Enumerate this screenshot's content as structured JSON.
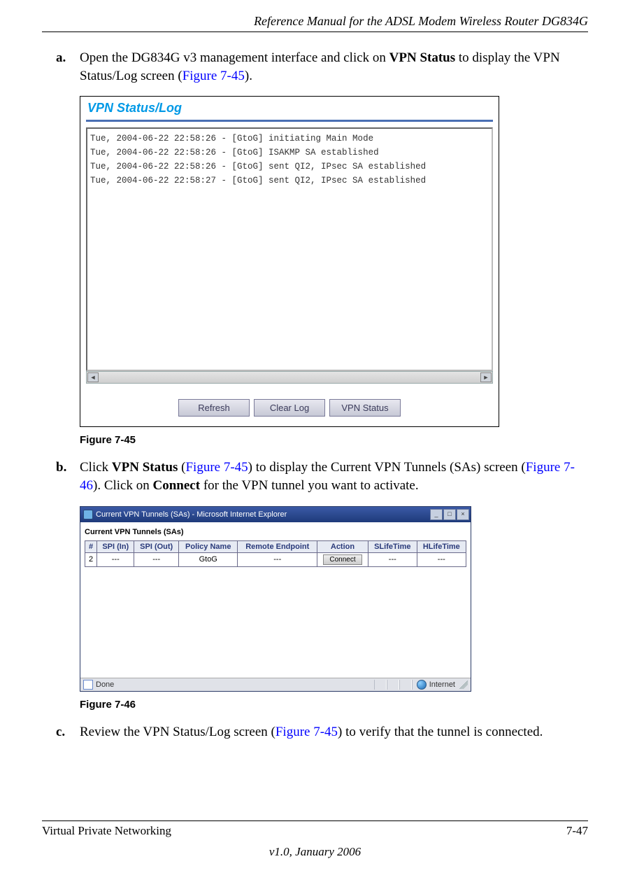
{
  "header": {
    "running_title": "Reference Manual for the ADSL Modem Wireless Router DG834G"
  },
  "step_a": {
    "letter": "a.",
    "pre": "Open the DG834G v3 management interface and click on ",
    "bold": "VPN Status",
    "mid": " to display the VPN Status/Log screen (",
    "link": "Figure 7-45",
    "post": ")."
  },
  "fig45": {
    "title": "VPN Status/Log",
    "log_lines": "Tue, 2004-06-22 22:58:26 - [GtoG] initiating Main Mode\nTue, 2004-06-22 22:58:26 - [GtoG] ISAKMP SA established\nTue, 2004-06-22 22:58:26 - [GtoG] sent QI2, IPsec SA established\nTue, 2004-06-22 22:58:27 - [GtoG] sent QI2, IPsec SA established",
    "buttons": {
      "refresh": "Refresh",
      "clear": "Clear Log",
      "status": "VPN Status"
    },
    "caption": "Figure 7-45"
  },
  "step_b": {
    "letter": "b.",
    "pre": "Click ",
    "bold": "VPN Status",
    "after_bold": " (",
    "link1": "Figure 7-45",
    "mid1": ") to display the Current VPN Tunnels (SAs) screen (",
    "link2": "Figure 7-46",
    "mid2": "). Click on ",
    "bold2": "Connect",
    "post": " for the VPN tunnel you want to activate."
  },
  "fig46": {
    "window_title": "Current VPN Tunnels (SAs) - Microsoft Internet Explorer",
    "heading": "Current VPN Tunnels (SAs)",
    "columns": {
      "c1": "#",
      "c2": "SPI (In)",
      "c3": "SPI (Out)",
      "c4": "Policy Name",
      "c5": "Remote Endpoint",
      "c6": "Action",
      "c7": "SLifeTime",
      "c8": "HLifeTime"
    },
    "row": {
      "num": "2",
      "spi_in": "---",
      "spi_out": "---",
      "policy": "GtoG",
      "endpoint": "---",
      "action": "Connect",
      "slife": "---",
      "hlife": "---"
    },
    "status_done": "Done",
    "status_zone": "Internet",
    "caption": "Figure 7-46"
  },
  "step_c": {
    "letter": "c.",
    "pre": "Review the VPN Status/Log screen (",
    "link": "Figure 7-45",
    "post": ") to verify that the tunnel is connected."
  },
  "footer": {
    "left": "Virtual Private Networking",
    "right": "7-47",
    "center": "v1.0, January 2006"
  }
}
